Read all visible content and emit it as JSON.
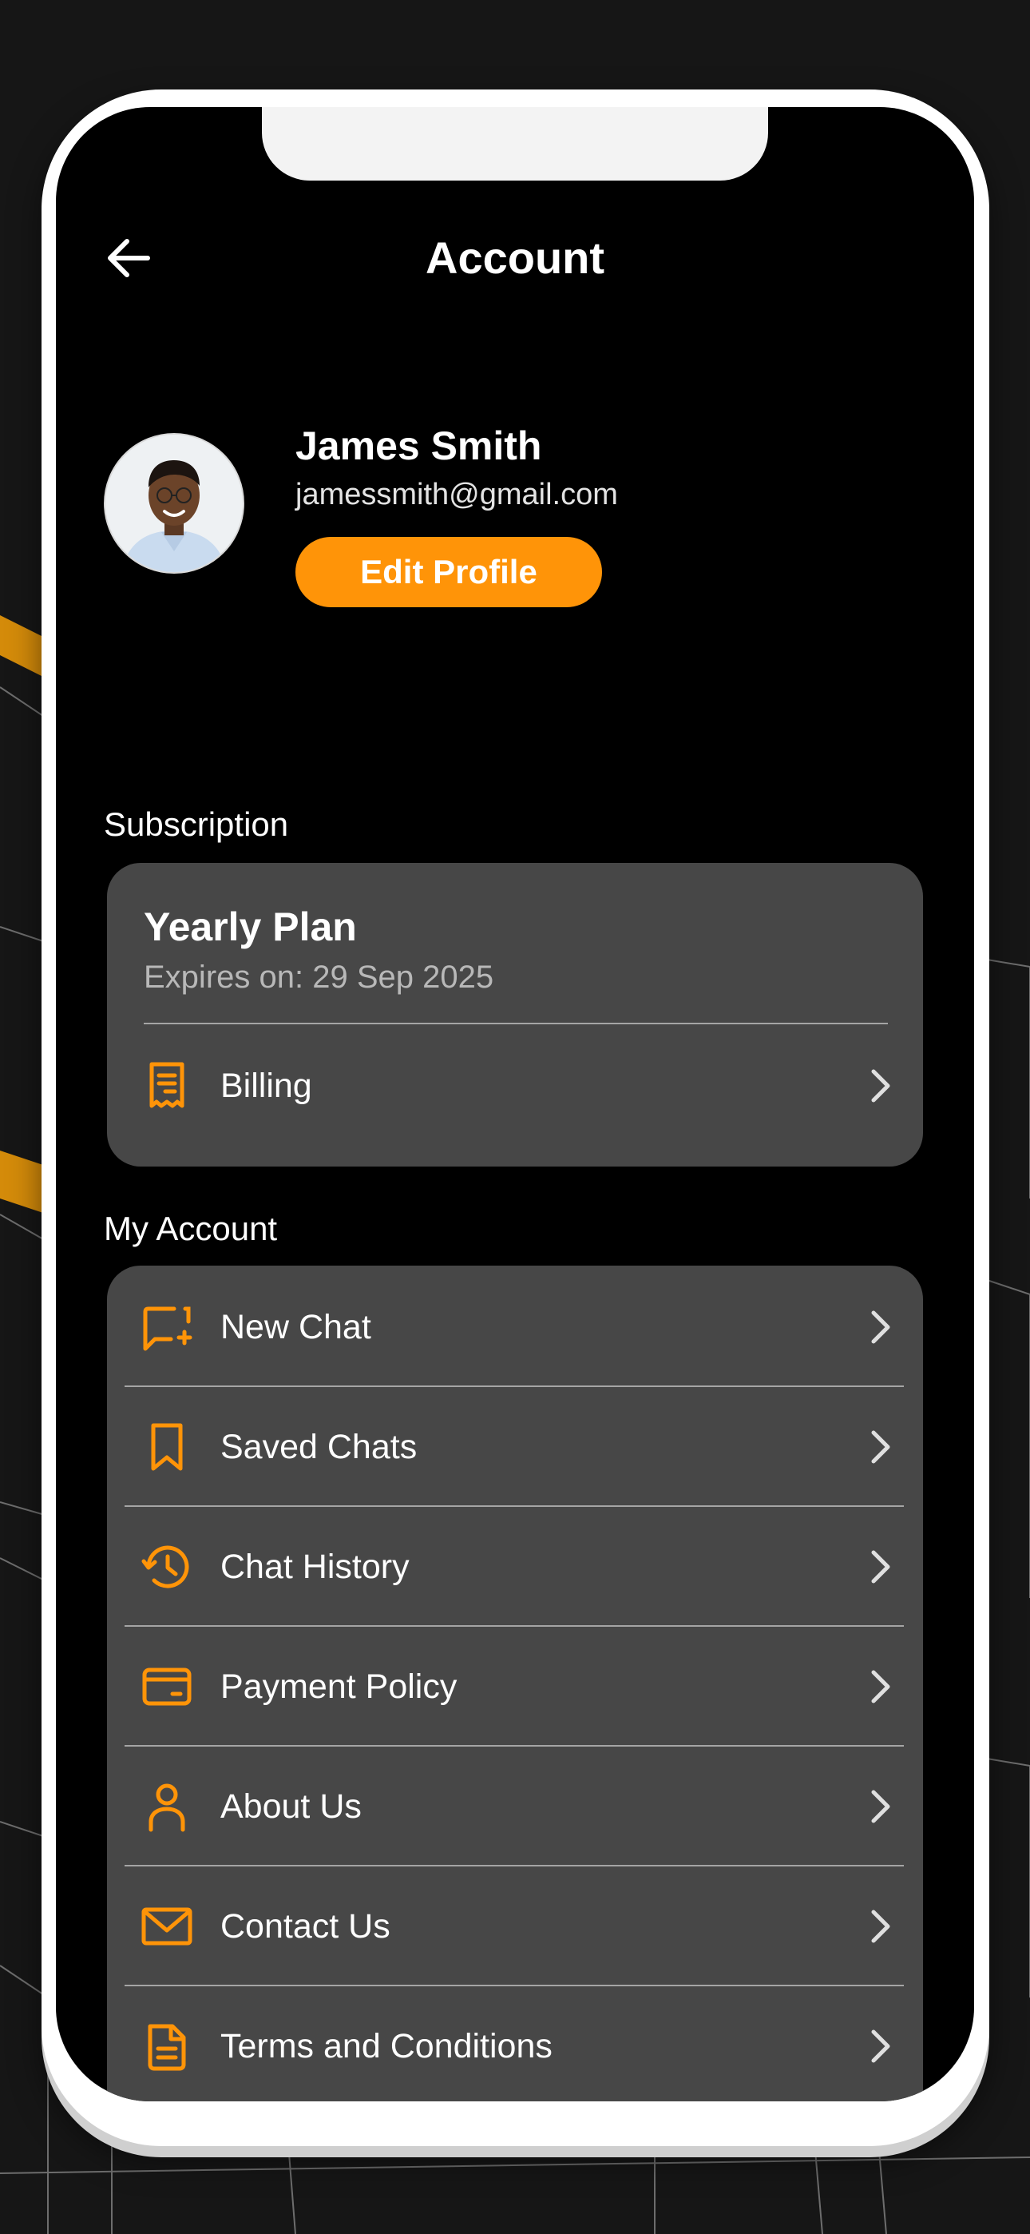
{
  "header": {
    "title": "Account",
    "back_icon": "arrow-left-icon"
  },
  "profile": {
    "name": "James Smith",
    "email": "jamessmith@gmail.com",
    "edit_label": "Edit Profile"
  },
  "subscription": {
    "section_label": "Subscription",
    "plan": "Yearly Plan",
    "expiry": "Expires on: 29 Sep 2025",
    "billing_label": "Billing",
    "billing_icon": "receipt-icon"
  },
  "my_account": {
    "section_label": "My Account",
    "items": [
      {
        "label": "New Chat",
        "icon": "chat-plus-icon"
      },
      {
        "label": "Saved Chats",
        "icon": "bookmark-icon"
      },
      {
        "label": "Chat History",
        "icon": "history-icon"
      },
      {
        "label": "Payment Policy",
        "icon": "credit-card-icon"
      },
      {
        "label": "About Us",
        "icon": "user-icon"
      },
      {
        "label": "Contact Us",
        "icon": "mail-icon"
      },
      {
        "label": "Terms and Conditions",
        "icon": "document-icon"
      }
    ]
  },
  "colors": {
    "accent": "#ff9408",
    "card": "#474747",
    "screen": "#000000",
    "background": "#161616"
  }
}
